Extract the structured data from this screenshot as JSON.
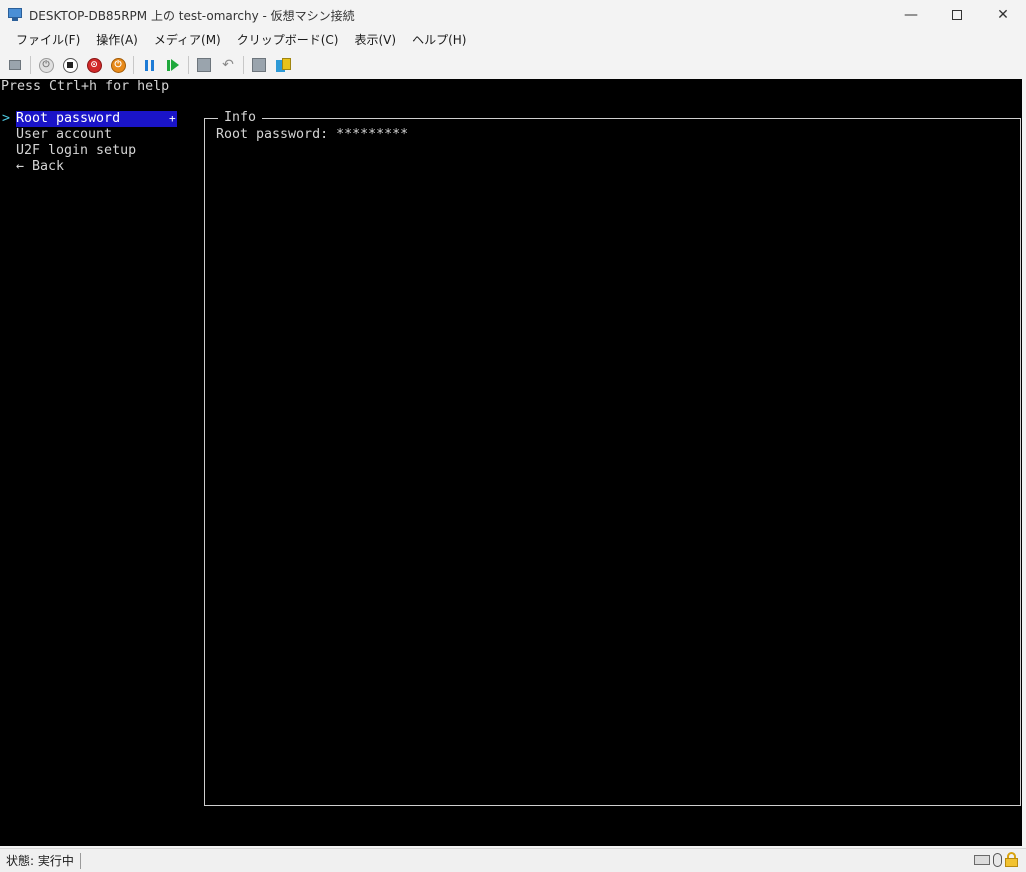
{
  "window": {
    "title": "DESKTOP-DB85RPM 上の test-omarchy  - 仮想マシン接続",
    "minimize": "—",
    "close": "✕"
  },
  "menu": [
    {
      "label": "ファイル(F)"
    },
    {
      "label": "操作(A)"
    },
    {
      "label": "メディア(M)"
    },
    {
      "label": "クリップボード(C)"
    },
    {
      "label": "表示(V)"
    },
    {
      "label": "ヘルプ(H)"
    }
  ],
  "toolbar": {
    "icons": [
      "ctrl-alt-del-icon",
      "start-icon",
      "turn-off-icon",
      "shut-down-icon",
      "save-state-icon",
      "pause-icon",
      "resume-icon",
      "checkpoint-icon",
      "revert-icon",
      "settings-icon",
      "enhanced-session-icon"
    ]
  },
  "console": {
    "help_text": "Press Ctrl+h for help",
    "cursor": ">",
    "expand_mark": "+",
    "menu_items": [
      {
        "label": "Root password",
        "selected": true
      },
      {
        "label": "User account",
        "selected": false
      },
      {
        "label": "U2F login setup",
        "selected": false
      },
      {
        "label": "← Back",
        "selected": false
      }
    ],
    "info": {
      "title": "Info",
      "line": "Root password: *********"
    },
    "colors": {
      "background": "#000000",
      "selection": "#1a14c8",
      "cursor": "#4ec9e0"
    }
  },
  "status": {
    "text": "状態: 実行中"
  }
}
